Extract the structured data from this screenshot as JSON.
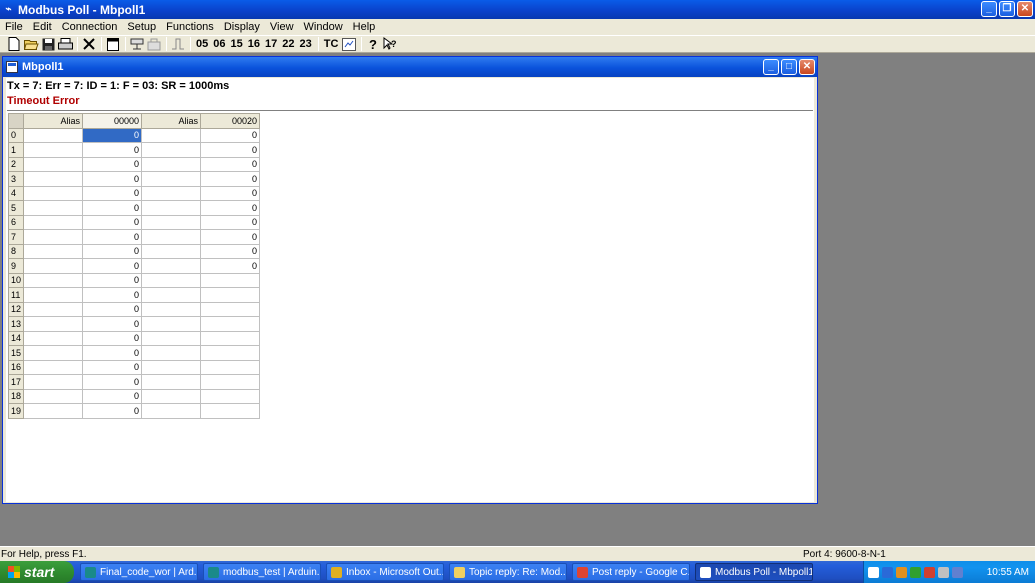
{
  "window": {
    "title": "Modbus Poll - Mbpoll1"
  },
  "menu": [
    "File",
    "Edit",
    "Connection",
    "Setup",
    "Functions",
    "Display",
    "View",
    "Window",
    "Help"
  ],
  "toolbar": {
    "icons": [
      "new-icon",
      "open-icon",
      "save-icon",
      "print-icon",
      "delete-icon",
      "window-icon",
      "connect-icon",
      "disconnect-icon",
      "pulse-icon"
    ],
    "function_codes": [
      "05",
      "06",
      "15",
      "16",
      "17",
      "22",
      "23"
    ],
    "tc_label": "TC",
    "help_icons": [
      "help-icon",
      "context-help-icon"
    ]
  },
  "child": {
    "title": "Mbpoll1",
    "status": "Tx = 7: Err = 7: ID = 1: F = 03: SR = 1000ms",
    "error": "Timeout Error",
    "columns": [
      "Alias",
      "00000",
      "Alias",
      "00020"
    ],
    "rows": [
      {
        "n": "0",
        "v1": "0",
        "v2": "0"
      },
      {
        "n": "1",
        "v1": "0",
        "v2": "0"
      },
      {
        "n": "2",
        "v1": "0",
        "v2": "0"
      },
      {
        "n": "3",
        "v1": "0",
        "v2": "0"
      },
      {
        "n": "4",
        "v1": "0",
        "v2": "0"
      },
      {
        "n": "5",
        "v1": "0",
        "v2": "0"
      },
      {
        "n": "6",
        "v1": "0",
        "v2": "0"
      },
      {
        "n": "7",
        "v1": "0",
        "v2": "0"
      },
      {
        "n": "8",
        "v1": "0",
        "v2": "0"
      },
      {
        "n": "9",
        "v1": "0",
        "v2": "0"
      },
      {
        "n": "10",
        "v1": "0",
        "v2": ""
      },
      {
        "n": "11",
        "v1": "0",
        "v2": ""
      },
      {
        "n": "12",
        "v1": "0",
        "v2": ""
      },
      {
        "n": "13",
        "v1": "0",
        "v2": ""
      },
      {
        "n": "14",
        "v1": "0",
        "v2": ""
      },
      {
        "n": "15",
        "v1": "0",
        "v2": ""
      },
      {
        "n": "16",
        "v1": "0",
        "v2": ""
      },
      {
        "n": "17",
        "v1": "0",
        "v2": ""
      },
      {
        "n": "18",
        "v1": "0",
        "v2": ""
      },
      {
        "n": "19",
        "v1": "0",
        "v2": ""
      }
    ]
  },
  "statusbar": {
    "help": "For Help, press F1.",
    "port": "Port 4: 9600-8-N-1"
  },
  "taskbar": {
    "start": "start",
    "tasks": [
      {
        "label": "Final_code_wor | Ard...",
        "color": "#1a8a8a"
      },
      {
        "label": "modbus_test | Arduin...",
        "color": "#1a8a8a"
      },
      {
        "label": "Inbox - Microsoft Out...",
        "color": "#e0b020"
      },
      {
        "label": "Topic reply: Re: Mod...",
        "color": "#f0d060"
      },
      {
        "label": "Post reply - Google C...",
        "color": "#dd4433"
      },
      {
        "label": "Modbus Poll - Mbpoll1",
        "color": "#ffffff"
      }
    ],
    "clock": "10:55 AM"
  }
}
